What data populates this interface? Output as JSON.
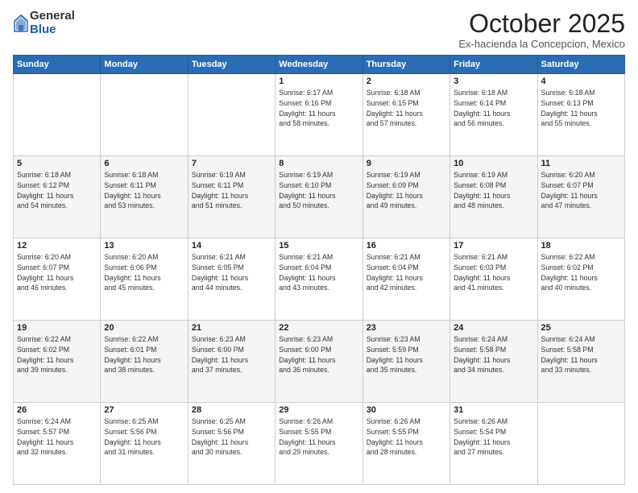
{
  "logo": {
    "general": "General",
    "blue": "Blue"
  },
  "header": {
    "month": "October 2025",
    "location": "Ex-hacienda la Concepcion, Mexico"
  },
  "weekdays": [
    "Sunday",
    "Monday",
    "Tuesday",
    "Wednesday",
    "Thursday",
    "Friday",
    "Saturday"
  ],
  "weeks": [
    [
      {
        "day": "",
        "info": ""
      },
      {
        "day": "",
        "info": ""
      },
      {
        "day": "",
        "info": ""
      },
      {
        "day": "1",
        "info": "Sunrise: 6:17 AM\nSunset: 6:16 PM\nDaylight: 11 hours\nand 58 minutes."
      },
      {
        "day": "2",
        "info": "Sunrise: 6:18 AM\nSunset: 6:15 PM\nDaylight: 11 hours\nand 57 minutes."
      },
      {
        "day": "3",
        "info": "Sunrise: 6:18 AM\nSunset: 6:14 PM\nDaylight: 11 hours\nand 56 minutes."
      },
      {
        "day": "4",
        "info": "Sunrise: 6:18 AM\nSunset: 6:13 PM\nDaylight: 11 hours\nand 55 minutes."
      }
    ],
    [
      {
        "day": "5",
        "info": "Sunrise: 6:18 AM\nSunset: 6:12 PM\nDaylight: 11 hours\nand 54 minutes."
      },
      {
        "day": "6",
        "info": "Sunrise: 6:18 AM\nSunset: 6:11 PM\nDaylight: 11 hours\nand 53 minutes."
      },
      {
        "day": "7",
        "info": "Sunrise: 6:19 AM\nSunset: 6:11 PM\nDaylight: 11 hours\nand 51 minutes."
      },
      {
        "day": "8",
        "info": "Sunrise: 6:19 AM\nSunset: 6:10 PM\nDaylight: 11 hours\nand 50 minutes."
      },
      {
        "day": "9",
        "info": "Sunrise: 6:19 AM\nSunset: 6:09 PM\nDaylight: 11 hours\nand 49 minutes."
      },
      {
        "day": "10",
        "info": "Sunrise: 6:19 AM\nSunset: 6:08 PM\nDaylight: 11 hours\nand 48 minutes."
      },
      {
        "day": "11",
        "info": "Sunrise: 6:20 AM\nSunset: 6:07 PM\nDaylight: 11 hours\nand 47 minutes."
      }
    ],
    [
      {
        "day": "12",
        "info": "Sunrise: 6:20 AM\nSunset: 6:07 PM\nDaylight: 11 hours\nand 46 minutes."
      },
      {
        "day": "13",
        "info": "Sunrise: 6:20 AM\nSunset: 6:06 PM\nDaylight: 11 hours\nand 45 minutes."
      },
      {
        "day": "14",
        "info": "Sunrise: 6:21 AM\nSunset: 6:05 PM\nDaylight: 11 hours\nand 44 minutes."
      },
      {
        "day": "15",
        "info": "Sunrise: 6:21 AM\nSunset: 6:04 PM\nDaylight: 11 hours\nand 43 minutes."
      },
      {
        "day": "16",
        "info": "Sunrise: 6:21 AM\nSunset: 6:04 PM\nDaylight: 11 hours\nand 42 minutes."
      },
      {
        "day": "17",
        "info": "Sunrise: 6:21 AM\nSunset: 6:03 PM\nDaylight: 11 hours\nand 41 minutes."
      },
      {
        "day": "18",
        "info": "Sunrise: 6:22 AM\nSunset: 6:02 PM\nDaylight: 11 hours\nand 40 minutes."
      }
    ],
    [
      {
        "day": "19",
        "info": "Sunrise: 6:22 AM\nSunset: 6:02 PM\nDaylight: 11 hours\nand 39 minutes."
      },
      {
        "day": "20",
        "info": "Sunrise: 6:22 AM\nSunset: 6:01 PM\nDaylight: 11 hours\nand 38 minutes."
      },
      {
        "day": "21",
        "info": "Sunrise: 6:23 AM\nSunset: 6:00 PM\nDaylight: 11 hours\nand 37 minutes."
      },
      {
        "day": "22",
        "info": "Sunrise: 6:23 AM\nSunset: 6:00 PM\nDaylight: 11 hours\nand 36 minutes."
      },
      {
        "day": "23",
        "info": "Sunrise: 6:23 AM\nSunset: 5:59 PM\nDaylight: 11 hours\nand 35 minutes."
      },
      {
        "day": "24",
        "info": "Sunrise: 6:24 AM\nSunset: 5:58 PM\nDaylight: 11 hours\nand 34 minutes."
      },
      {
        "day": "25",
        "info": "Sunrise: 6:24 AM\nSunset: 5:58 PM\nDaylight: 11 hours\nand 33 minutes."
      }
    ],
    [
      {
        "day": "26",
        "info": "Sunrise: 6:24 AM\nSunset: 5:57 PM\nDaylight: 11 hours\nand 32 minutes."
      },
      {
        "day": "27",
        "info": "Sunrise: 6:25 AM\nSunset: 5:56 PM\nDaylight: 11 hours\nand 31 minutes."
      },
      {
        "day": "28",
        "info": "Sunrise: 6:25 AM\nSunset: 5:56 PM\nDaylight: 11 hours\nand 30 minutes."
      },
      {
        "day": "29",
        "info": "Sunrise: 6:26 AM\nSunset: 5:55 PM\nDaylight: 11 hours\nand 29 minutes."
      },
      {
        "day": "30",
        "info": "Sunrise: 6:26 AM\nSunset: 5:55 PM\nDaylight: 11 hours\nand 28 minutes."
      },
      {
        "day": "31",
        "info": "Sunrise: 6:26 AM\nSunset: 5:54 PM\nDaylight: 11 hours\nand 27 minutes."
      },
      {
        "day": "",
        "info": ""
      }
    ]
  ]
}
